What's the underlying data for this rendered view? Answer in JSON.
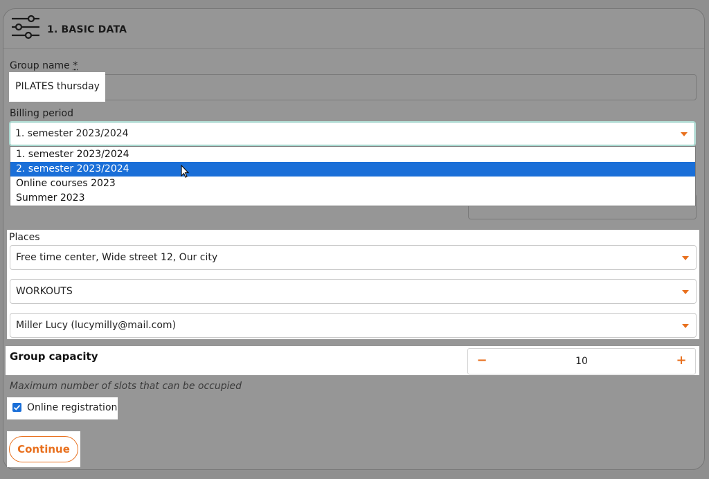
{
  "section": {
    "title": "1. BASIC DATA"
  },
  "group_name": {
    "label": "Group name",
    "required_mark": "*",
    "value": "PILATES thursday"
  },
  "billing_period": {
    "label": "Billing period",
    "value": "1. semester 2023/2024",
    "options": [
      "1. semester 2023/2024",
      "2. semester 2023/2024",
      "Online courses 2023",
      "Summer 2023"
    ],
    "highlighted_index": 1
  },
  "places": {
    "label": "Places",
    "place": "Free time center, Wide street 12, Our city",
    "category": "WORKOUTS",
    "instructor": "Miller Lucy (lucymilly@mail.com)"
  },
  "capacity": {
    "label": "Group capacity",
    "value": "10",
    "decrement": "−",
    "increment": "+",
    "hint": "Maximum number of slots that can be occupied"
  },
  "online_registration": {
    "label": "Online registration",
    "checked": true
  },
  "actions": {
    "continue": "Continue"
  },
  "colors": {
    "accent": "#e8701e",
    "selection": "#1a6fd8"
  }
}
